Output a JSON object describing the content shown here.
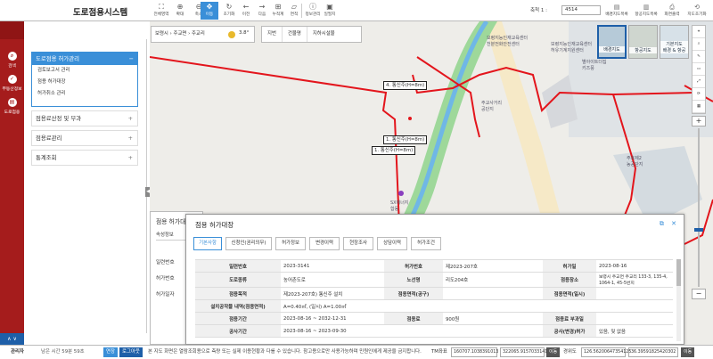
{
  "app": {
    "title": "도로점용시스템"
  },
  "toolbar": {
    "items": [
      {
        "label": "전체영역",
        "icon": "⛶"
      },
      {
        "label": "확대",
        "icon": "⊕"
      },
      {
        "label": "축소",
        "icon": "⊖"
      },
      {
        "label": "이동",
        "icon": "✥",
        "active": true
      },
      {
        "label": "초기화",
        "icon": "↻"
      },
      {
        "label": "이전",
        "icon": "←"
      },
      {
        "label": "다음",
        "icon": "→"
      },
      {
        "label": "누적계",
        "icon": "⊞"
      },
      {
        "label": "면적",
        "icon": "▱"
      },
      {
        "label": "정보관리",
        "icon": "ⓘ"
      },
      {
        "label": "일필지",
        "icon": "▣"
      }
    ]
  },
  "scale": {
    "label": "축척 1 :",
    "value": "4514"
  },
  "top_right": {
    "items": [
      {
        "label": "배경지도목록",
        "icon": "▤"
      },
      {
        "label": "항공지도목록",
        "icon": "▥"
      },
      {
        "label": "화면출력",
        "icon": "⎙"
      },
      {
        "label": "지도초기화",
        "icon": "⟲"
      }
    ]
  },
  "rail": {
    "items": [
      {
        "label": "검색",
        "icon": "⌕"
      },
      {
        "label": "부동산정보",
        "icon": "✓"
      },
      {
        "label": "도로점용",
        "icon": "▤"
      }
    ],
    "arrows": "∧ ∨"
  },
  "menu": {
    "active_section": "도로점용 허가관리",
    "collapse_symbol": "−",
    "sub_items": [
      "검토보고서 관리",
      "점용 허가대장",
      "허가취소 관리"
    ],
    "sections": [
      "점용료산정 및 부과",
      "점용료관리",
      "통계조회"
    ],
    "expand_symbol": "+"
  },
  "map": {
    "address": {
      "city": "보령시",
      "dong": "주교면",
      "ri": "주교리",
      "sep": "›",
      "temperature": "3.8°"
    },
    "layer_tabs": [
      "지번",
      "건물명",
      "지하시설물"
    ],
    "map_types": [
      "배경지도",
      "항공지도",
      "기본지도\n배경 & 항공"
    ],
    "right_tools": [
      "⌖",
      "⌕",
      "✎",
      "▭",
      "⤢",
      "⟳",
      "▦"
    ],
    "zoom": {
      "plus": "+",
      "minus": "−"
    },
    "labels": [
      "보령지능인재교육센터\n천분전화안전센터",
      "보령지능인재교육센터\n허유기계지원센터",
      "별아이트더집\n키즈풍",
      "주교사거리\n공단지",
      "주교북교수\n공공해지",
      "주호제2\n농공단지",
      "SX에너지\n합동"
    ],
    "tags": [
      "4. 통신주(H=8m)",
      "1. 통신주(H=8m)",
      "1. 통신주(H=8m)"
    ]
  },
  "back_dialog": {
    "title": "점용 허가대",
    "tab": "속성정보",
    "rows": [
      "일련번호",
      "허가번호",
      "허가일자"
    ]
  },
  "dialog": {
    "title": "점용 허가대장",
    "icons": [
      "⧉",
      "✕"
    ],
    "tabs": [
      "기본사항",
      "신청인(권리의무)",
      "허가정보",
      "변경이력",
      "현장조사",
      "상담이력",
      "허가조건"
    ],
    "rows": [
      [
        "일련번호",
        "2023-3141",
        "허가번호",
        "제2023-207호",
        "허가일",
        "2023-08-16"
      ],
      [
        "도로종류",
        "농어촌도로",
        "노선명",
        "리도204호",
        "점용장소",
        "보령시 주교면 주교리 133-3, 135-4, 1064-1, 45-5번지"
      ],
      [
        "점용목적",
        "제2023-207호) 통신주 설치",
        "점용면적(공구)",
        "",
        "점용면적(일시)",
        ""
      ],
      [
        "설치공작물 내역(점용면적)",
        "A=0.40㎡, (일시) A=1.00㎡",
        "",
        "",
        "",
        ""
      ],
      [
        "점용기간",
        "2023-08-16 ~ 2032-12-31",
        "점용료",
        "900원",
        "점용료 부과일",
        ""
      ],
      [
        "공사기간",
        "2023-08-16 ~ 2023-09-30",
        "",
        "",
        "공사(변경)허가",
        "있음, 및 없음"
      ]
    ]
  },
  "status": {
    "admin": "관리자",
    "remaining": "남은 시간 59분 59초",
    "extend": "연장",
    "logout": "로그아웃",
    "notice": "본 지도 화면은 열람조회용으로 측량 또는 실제 이용현황과 다를 수 있습니다. 참고용으로만 사용가능하며 민원인에게 제공을 금지합니다.",
    "tm_label": "TM좌표",
    "tm_x": "160707.1038391013",
    "tm_y": "322065.9157033141",
    "move1": "이동",
    "geo_label": "경위도",
    "geo_x": "126.56200647354125",
    "geo_y": "36.39591825420302",
    "move2": "이동"
  },
  "colors": {
    "accent": "#3a8fd8",
    "rail": "#a51c1c",
    "boundary": "#e3151c",
    "river": "#8fd08d"
  }
}
